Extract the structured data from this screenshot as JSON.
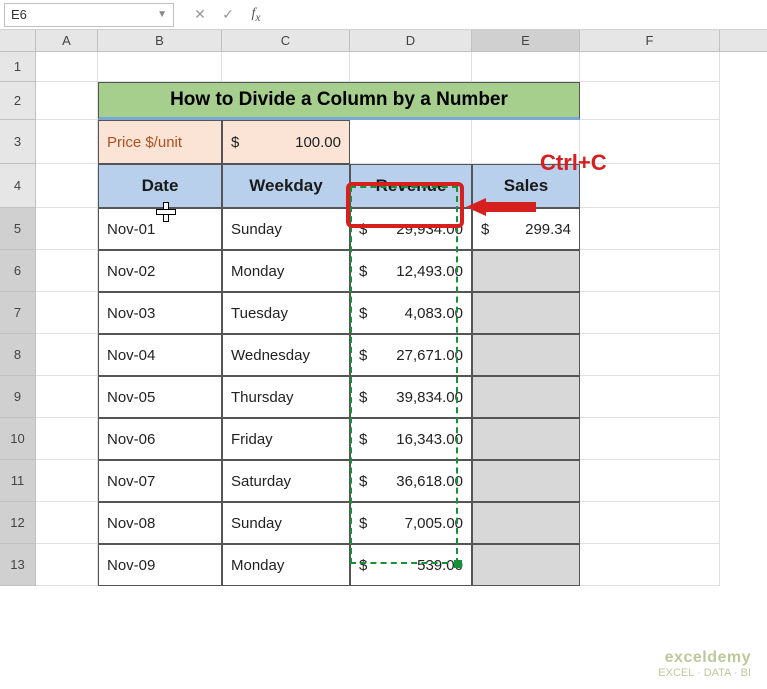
{
  "namebox": "E6",
  "formula": "",
  "columns": [
    "A",
    "B",
    "C",
    "D",
    "E",
    "F"
  ],
  "row_labels": [
    "1",
    "2",
    "3",
    "4",
    "5",
    "6",
    "7",
    "8",
    "9",
    "10",
    "11",
    "12",
    "13"
  ],
  "title": "How to Divide a Column by a Number",
  "price_label": "Price $/unit",
  "price_currency": "$",
  "price_value": "100.00",
  "headers": {
    "date": "Date",
    "weekday": "Weekday",
    "revenue": "Revenue",
    "sales": "Sales"
  },
  "table": [
    {
      "date": "Nov-01",
      "weekday": "Sunday",
      "rev": "29,934.00",
      "sales": "299.34"
    },
    {
      "date": "Nov-02",
      "weekday": "Monday",
      "rev": "12,493.00",
      "sales": ""
    },
    {
      "date": "Nov-03",
      "weekday": "Tuesday",
      "rev": "4,083.00",
      "sales": ""
    },
    {
      "date": "Nov-04",
      "weekday": "Wednesday",
      "rev": "27,671.00",
      "sales": ""
    },
    {
      "date": "Nov-05",
      "weekday": "Thursday",
      "rev": "39,834.00",
      "sales": ""
    },
    {
      "date": "Nov-06",
      "weekday": "Friday",
      "rev": "16,343.00",
      "sales": ""
    },
    {
      "date": "Nov-07",
      "weekday": "Saturday",
      "rev": "36,618.00",
      "sales": ""
    },
    {
      "date": "Nov-08",
      "weekday": "Sunday",
      "rev": "7,005.00",
      "sales": ""
    },
    {
      "date": "Nov-09",
      "weekday": "Monday",
      "rev": "539.00",
      "sales": ""
    }
  ],
  "annotation": {
    "shortcut": "Ctrl+C"
  },
  "watermark": {
    "brand": "exceldemy",
    "tag": "EXCEL · DATA · BI"
  },
  "dollar": "$"
}
